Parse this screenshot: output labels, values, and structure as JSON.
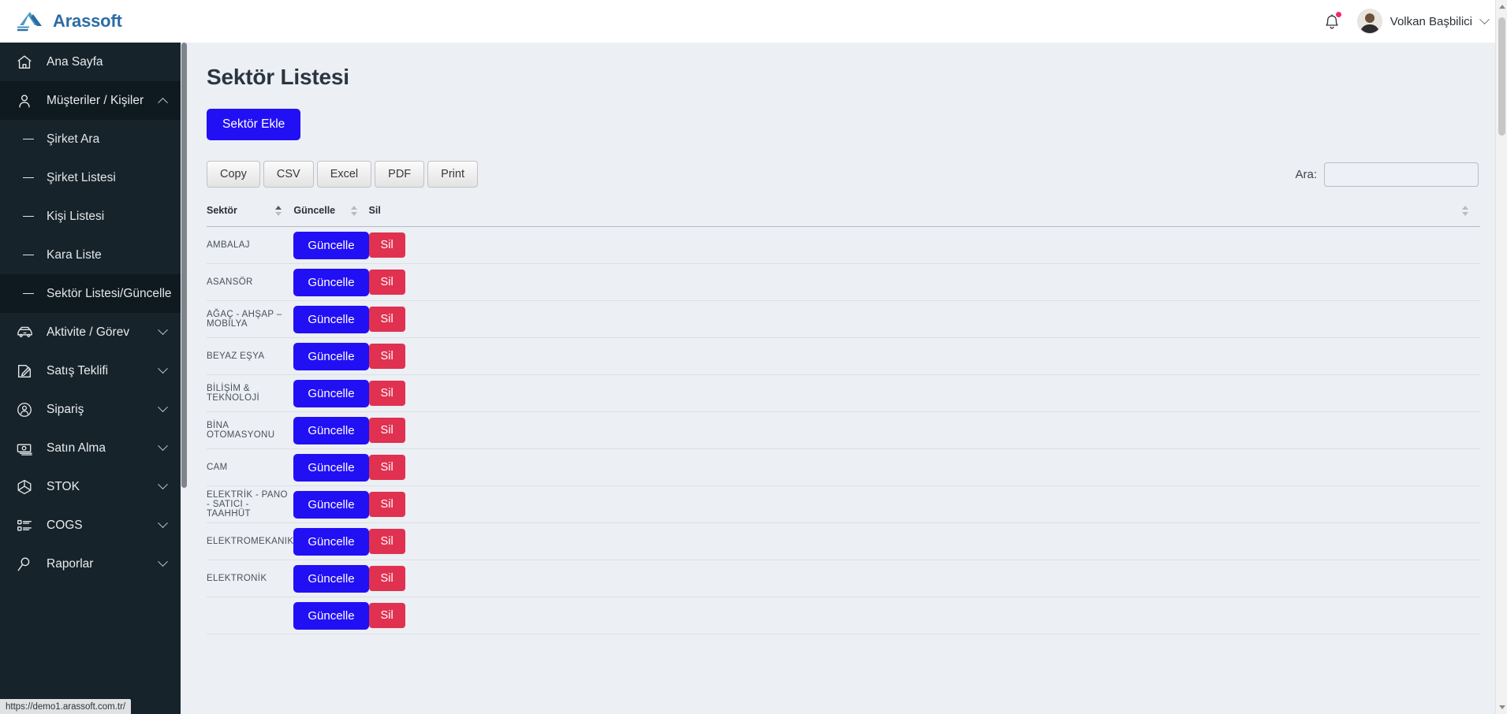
{
  "header": {
    "brand_name": "Arassoft",
    "brand_logo_icon": "arassoft-mountain-logo",
    "notification_icon": "bell-icon",
    "has_notification_dot": true,
    "user_name": "Volkan Başbilici",
    "user_menu_icon": "chevron-down-icon",
    "avatar_icon": "user-avatar-photo"
  },
  "sidebar": {
    "items": [
      {
        "label": "Ana Sayfa",
        "icon": "home-icon",
        "state": "normal",
        "caret": "none"
      },
      {
        "label": "Müşteriler / Kişiler",
        "icon": "user-icon",
        "state": "active-parent",
        "caret": "up"
      },
      {
        "label": "Aktivite / Görev",
        "icon": "car-icon",
        "state": "normal",
        "caret": "down"
      },
      {
        "label": "Satış Teklifi",
        "icon": "edit-document-icon",
        "state": "normal",
        "caret": "down"
      },
      {
        "label": "Sipariş",
        "icon": "user-circle-icon",
        "state": "normal",
        "caret": "down"
      },
      {
        "label": "Satın Alma",
        "icon": "money-icon",
        "state": "normal",
        "caret": "down"
      },
      {
        "label": "STOK",
        "icon": "cube-icon",
        "state": "normal",
        "caret": "down"
      },
      {
        "label": "COGS",
        "icon": "list-icon",
        "state": "normal",
        "caret": "down"
      },
      {
        "label": "Raporlar",
        "icon": "magnifier-icon",
        "state": "normal",
        "caret": "down"
      }
    ],
    "submenu": [
      {
        "label": "Şirket Ara",
        "state": "normal"
      },
      {
        "label": "Şirket Listesi",
        "state": "normal"
      },
      {
        "label": "Kişi Listesi",
        "state": "normal"
      },
      {
        "label": "Kara Liste",
        "state": "normal"
      },
      {
        "label": "Sektör Listesi/Güncelle",
        "state": "active"
      }
    ]
  },
  "main": {
    "page_title": "Sektör Listesi",
    "add_button_label": "Sektör Ekle",
    "export_buttons": [
      "Copy",
      "CSV",
      "Excel",
      "PDF",
      "Print"
    ],
    "search_label": "Ara:",
    "search_value": "",
    "search_placeholder": "",
    "table": {
      "columns": [
        {
          "label": "Sektör",
          "sort": "asc"
        },
        {
          "label": "Güncelle",
          "sort": "none"
        },
        {
          "label": "Sil",
          "sort": "none"
        }
      ],
      "update_label": "Güncelle",
      "delete_label": "Sil",
      "rows": [
        {
          "sektor": "AMBALAJ"
        },
        {
          "sektor": "ASANSÖR"
        },
        {
          "sektor": "AĞAÇ - AHŞAP – MOBİLYA"
        },
        {
          "sektor": "BEYAZ EŞYA"
        },
        {
          "sektor": "BİLİŞİM & TEKNOLOJİ"
        },
        {
          "sektor": "BİNA OTOMASYONU"
        },
        {
          "sektor": "CAM"
        },
        {
          "sektor": "ELEKTRİK - PANO - SATICI - TAAHHÜT"
        },
        {
          "sektor": "ELEKTROMEKANIK"
        },
        {
          "sektor": "ELEKTRONİK"
        },
        {
          "sektor": ""
        }
      ]
    }
  },
  "statusbar": {
    "url": "https://demo1.arassoft.com.tr/"
  },
  "colors": {
    "sidebar_bg": "#16232b",
    "sidebar_active": "#0e1920",
    "primary_blue": "#2210f5",
    "danger_red": "#e03151",
    "brand_blue": "#2c6ca3",
    "content_bg": "#eceff4"
  }
}
